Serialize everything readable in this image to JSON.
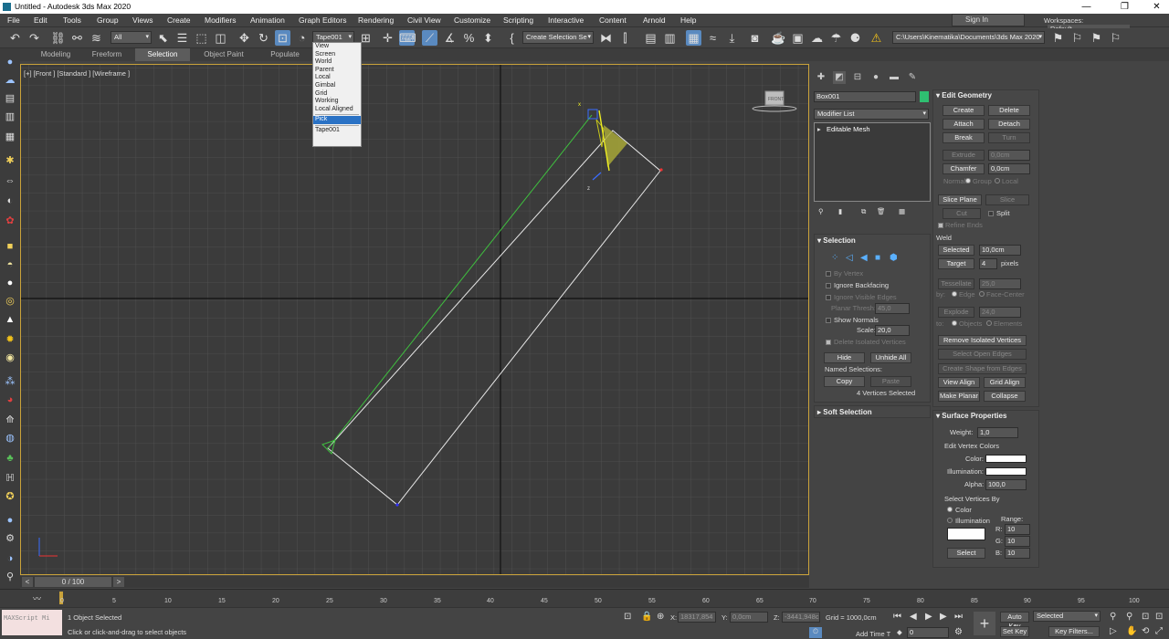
{
  "window": {
    "title": "Untitled - Autodesk 3ds Max 2020",
    "controls": [
      "—",
      "❐",
      "✕"
    ]
  },
  "menu": [
    "File",
    "Edit",
    "Tools",
    "Group",
    "Views",
    "Create",
    "Modifiers",
    "Animation",
    "Graph Editors",
    "Rendering",
    "Civil View",
    "Customize",
    "Scripting",
    "Interactive",
    "Content",
    "Arnold",
    "Help"
  ],
  "signin": "Sign In",
  "workspaces": {
    "label": "Workspaces:",
    "value": "Default"
  },
  "toolbar": {
    "filter": "All",
    "coord_system": "Tape001",
    "selection_set": "Create Selection Se",
    "project_path": "C:\\Users\\Kinematika\\Documents\\3ds Max 2020"
  },
  "coord_dropdown": {
    "items": [
      "View",
      "Screen",
      "World",
      "Parent",
      "Local",
      "Gimbal",
      "Grid",
      "Working",
      "Local Aligned"
    ],
    "selected": "Pick",
    "extra": "Tape001"
  },
  "ribbon": {
    "tabs": [
      "Modeling",
      "Freeform",
      "Selection",
      "Object Paint",
      "Populate"
    ],
    "active": "Selection"
  },
  "viewport": {
    "label": "[+] [Front ] [Standard ] [Wireframe ]",
    "viewcube": "FRONT",
    "gizmo": {
      "x": "x",
      "z": "z"
    }
  },
  "command_panel": {
    "object_name": "Box001",
    "object_color": "#2fbf71",
    "modifier_list": "Modifier List",
    "stack_item": "Editable Mesh",
    "selection": {
      "title": "Selection",
      "by_vertex": "By Vertex",
      "ignore_backfacing": "Ignore Backfacing",
      "ignore_visible_edges": "Ignore Visible Edges",
      "planar_thresh_label": "Planar Thresh:",
      "planar_thresh": "45,0",
      "show_normals": "Show Normals",
      "scale_label": "Scale:",
      "scale": "20,0",
      "delete_isolated": "Delete Isolated Vertices",
      "hide": "Hide",
      "unhide_all": "Unhide All",
      "named_selections": "Named Selections:",
      "copy": "Copy",
      "paste": "Paste",
      "status": "4 Vertices Selected"
    },
    "soft_selection": "Soft Selection",
    "edit_geometry": {
      "title": "Edit Geometry",
      "create": "Create",
      "delete": "Delete",
      "attach": "Attach",
      "detach": "Detach",
      "break": "Break",
      "turn": "Turn",
      "extrude": "Extrude",
      "extrude_val": "0,0cm",
      "chamfer": "Chamfer",
      "chamfer_val": "0,0cm",
      "normal_label": "Normal:",
      "group": "Group",
      "local": "Local",
      "slice_plane": "Slice Plane",
      "slice": "Slice",
      "cut": "Cut",
      "split": "Split",
      "refine_ends": "Refine Ends",
      "weld": "Weld",
      "selected": "Selected",
      "selected_val": "10,0cm",
      "target": "Target",
      "target_val": "4",
      "pixels": "pixels",
      "tessellate": "Tessellate",
      "tessellate_val": "25,0",
      "by_label": "by:",
      "edge": "Edge",
      "face_center": "Face-Center",
      "explode": "Explode",
      "explode_val": "24,0",
      "to_label": "to:",
      "objects": "Objects",
      "elements": "Elements",
      "remove_isolated": "Remove Isolated Vertices",
      "select_open_edges": "Select Open Edges",
      "create_shape": "Create Shape from Edges",
      "view_align": "View Align",
      "grid_align": "Grid Align",
      "make_planar": "Make Planar",
      "collapse": "Collapse"
    },
    "surface_properties": {
      "title": "Surface Properties",
      "weight_label": "Weight:",
      "weight": "1,0",
      "edit_vertex_colors": "Edit Vertex Colors",
      "color": "Color:",
      "illumination": "Illumination:",
      "alpha_label": "Alpha:",
      "alpha": "100,0",
      "select_vertices_by": "Select Vertices By",
      "by_color": "Color",
      "by_illumination": "Illumination",
      "range": "Range:",
      "r": "R:",
      "g": "G:",
      "b": "B:",
      "r_val": "10",
      "g_val": "10",
      "b_val": "10",
      "select": "Select"
    }
  },
  "time_slider": {
    "value": "0 / 100"
  },
  "timeline_ticks": [
    "0",
    "5",
    "10",
    "15",
    "20",
    "25",
    "30",
    "35",
    "40",
    "45",
    "50",
    "55",
    "60",
    "65",
    "70",
    "75",
    "80",
    "85",
    "90",
    "95",
    "100"
  ],
  "status": {
    "maxscript": "MAXScript Mi",
    "selected": "1 Object Selected",
    "prompt": "Click or click-and-drag to select objects",
    "x_label": "X:",
    "x": "18317,854",
    "y_label": "Y:",
    "y": "0,0cm",
    "z_label": "Z:",
    "z": "-3441,948c",
    "grid": "Grid = 1000,0cm",
    "add_time_tag": "Add Time T",
    "frame": "0",
    "auto_key": "Auto Key",
    "set_key": "Set Key",
    "key_mode": "Selected",
    "key_filters": "Key Filters..."
  }
}
